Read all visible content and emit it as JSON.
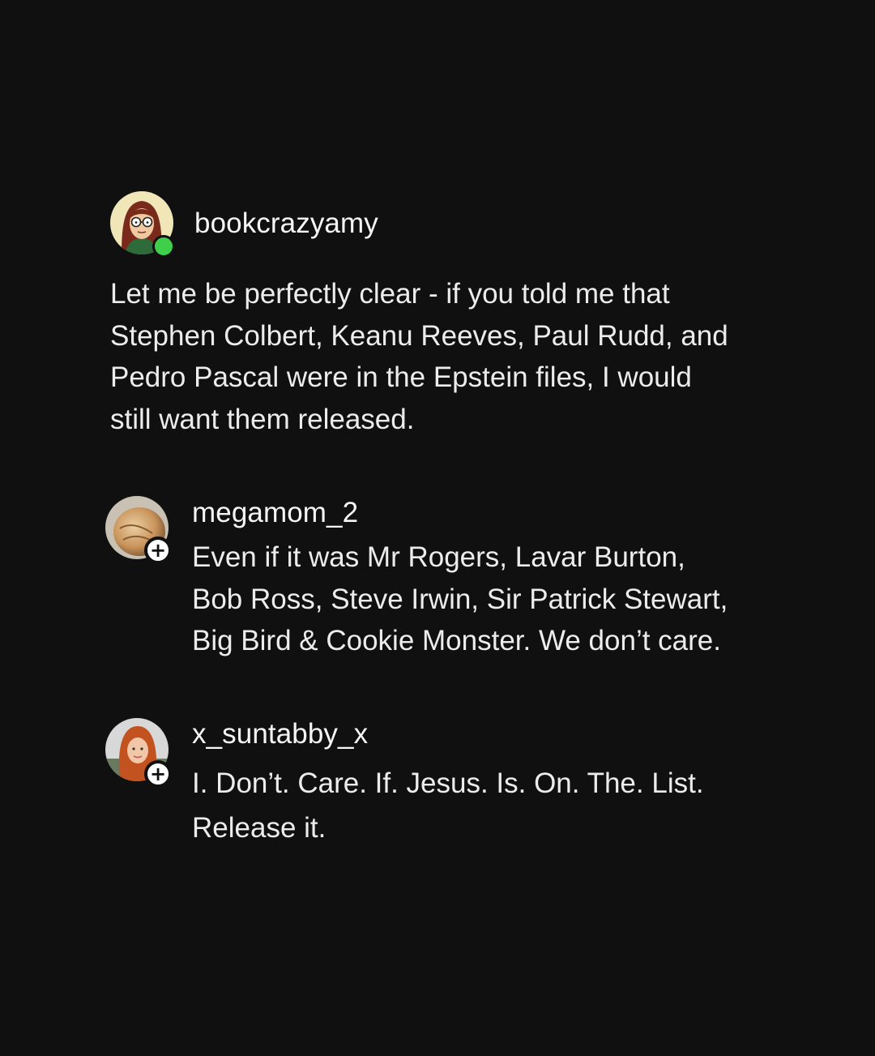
{
  "post": {
    "author": "bookcrazyamy",
    "text": "Let me be perfectly clear - if you told me that\nStephen Colbert, Keanu Reeves, Paul Rudd, and\nPedro Pascal were in the Epstein files, I would\nstill want them released.",
    "avatar_icon": "cartoon-character-avatar",
    "online_status_color": "#3fcf4a"
  },
  "replies": [
    {
      "author": "megamom_2",
      "text": "Even if it was Mr Rogers, Lavar Burton,\nBob Ross, Steve Irwin, Sir Patrick Stewart,\nBig Bird & Cookie Monster. We don’t care.",
      "follow_icon": "plus-icon"
    },
    {
      "author": "x_suntabby_x",
      "text": "I. Don’t. Care. If. Jesus. Is. On. The. List.\nRelease it.",
      "follow_icon": "plus-icon"
    }
  ],
  "colors": {
    "background": "#101010",
    "text": "#ececec"
  }
}
